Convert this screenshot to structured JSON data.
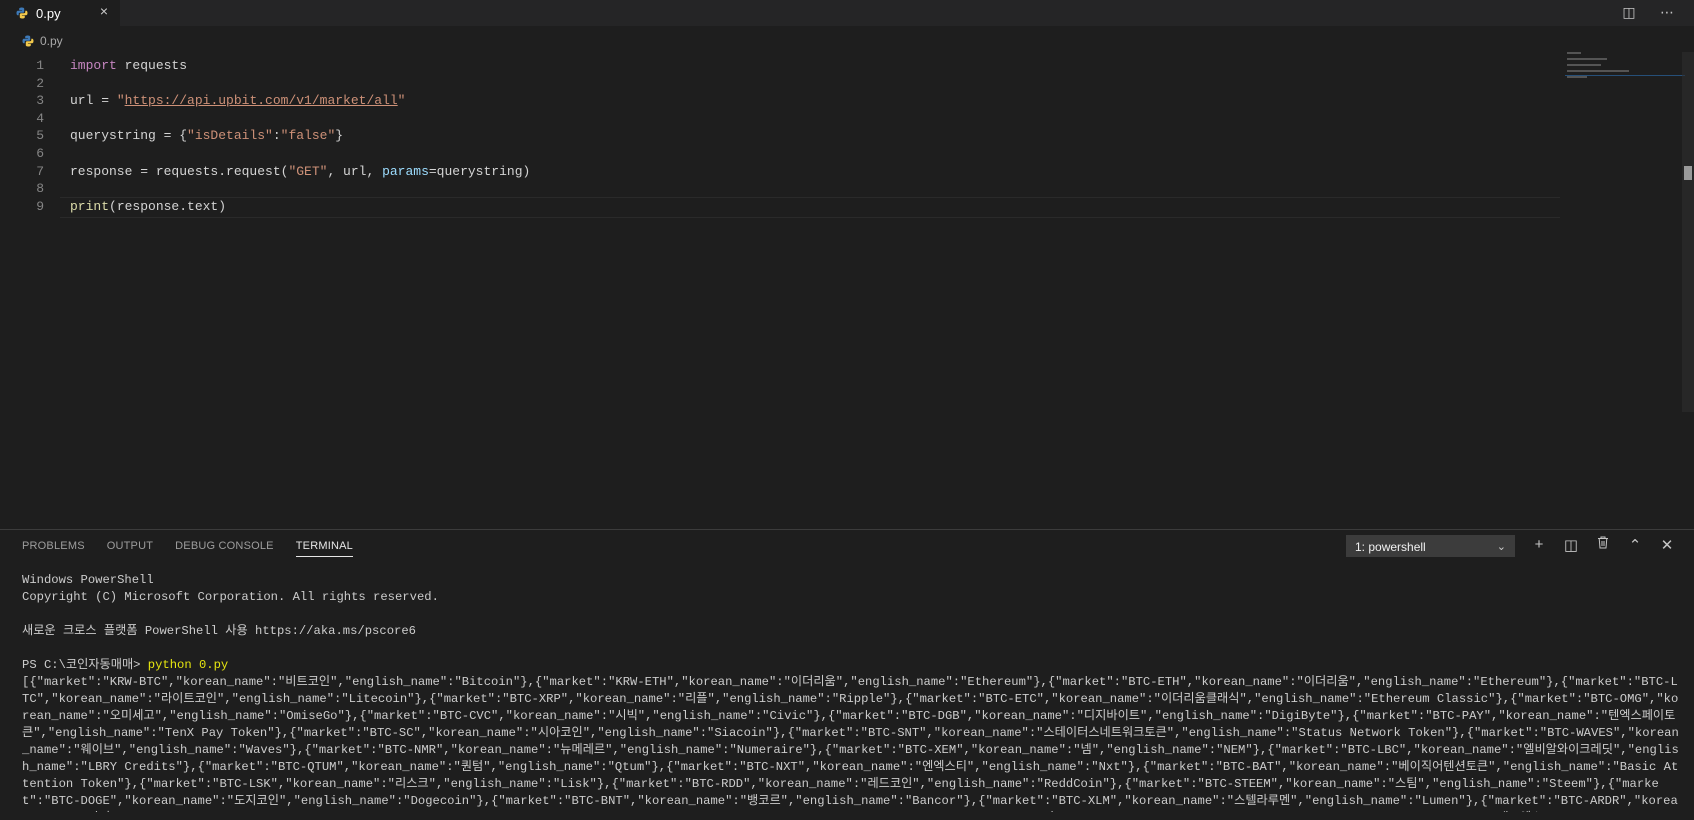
{
  "tab": {
    "filename": "0.py",
    "close": "×"
  },
  "tab_actions": {
    "split": "◫",
    "more": "⋯"
  },
  "breadcrumb": {
    "filename": "0.py"
  },
  "editor": {
    "lines": [
      {
        "n": "1",
        "tokens": [
          {
            "t": "import",
            "c": "kw"
          },
          {
            "t": " requests",
            "c": "id"
          }
        ]
      },
      {
        "n": "2",
        "tokens": []
      },
      {
        "n": "3",
        "tokens": [
          {
            "t": "url = ",
            "c": "id"
          },
          {
            "t": "\"",
            "c": "str"
          },
          {
            "t": "https://api.upbit.com/v1/market/all",
            "c": "url"
          },
          {
            "t": "\"",
            "c": "str"
          }
        ]
      },
      {
        "n": "4",
        "tokens": []
      },
      {
        "n": "5",
        "tokens": [
          {
            "t": "querystring = {",
            "c": "id"
          },
          {
            "t": "\"isDetails\"",
            "c": "str"
          },
          {
            "t": ":",
            "c": "id"
          },
          {
            "t": "\"false\"",
            "c": "str"
          },
          {
            "t": "}",
            "c": "id"
          }
        ]
      },
      {
        "n": "6",
        "tokens": []
      },
      {
        "n": "7",
        "tokens": [
          {
            "t": "response = requests.request(",
            "c": "id"
          },
          {
            "t": "\"GET\"",
            "c": "str"
          },
          {
            "t": ", url, ",
            "c": "id"
          },
          {
            "t": "params",
            "c": "param"
          },
          {
            "t": "=querystring)",
            "c": "id"
          }
        ]
      },
      {
        "n": "8",
        "tokens": []
      },
      {
        "n": "9",
        "tokens": [
          {
            "t": "print",
            "c": "fn"
          },
          {
            "t": "(response.text)",
            "c": "id"
          }
        ]
      }
    ]
  },
  "panel": {
    "tabs": [
      "PROBLEMS",
      "OUTPUT",
      "DEBUG CONSOLE",
      "TERMINAL"
    ],
    "active_tab": "TERMINAL",
    "terminal_select": "1: powershell",
    "icons": {
      "add": "+",
      "split": "◫",
      "trash": "🗑",
      "maximize": "⌃",
      "close": "✕"
    }
  },
  "terminal": {
    "line1": "Windows PowerShell",
    "line2": "Copyright (C) Microsoft Corporation. All rights reserved.",
    "line3": "",
    "line4": "새로운 크로스 플랫폼 PowerShell 사용 https://aka.ms/pscore6",
    "line5": "",
    "prompt": "PS C:\\코인자동매매> ",
    "command": "python 0.py",
    "output": "[{\"market\":\"KRW-BTC\",\"korean_name\":\"비트코인\",\"english_name\":\"Bitcoin\"},{\"market\":\"KRW-ETH\",\"korean_name\":\"이더리움\",\"english_name\":\"Ethereum\"},{\"market\":\"BTC-ETH\",\"korean_name\":\"이더리움\",\"english_name\":\"Ethereum\"},{\"market\":\"BTC-LTC\",\"korean_name\":\"라이트코인\",\"english_name\":\"Litecoin\"},{\"market\":\"BTC-XRP\",\"korean_name\":\"리플\",\"english_name\":\"Ripple\"},{\"market\":\"BTC-ETC\",\"korean_name\":\"이더리움클래식\",\"english_name\":\"Ethereum Classic\"},{\"market\":\"BTC-OMG\",\"korean_name\":\"오미세고\",\"english_name\":\"OmiseGo\"},{\"market\":\"BTC-CVC\",\"korean_name\":\"시빅\",\"english_name\":\"Civic\"},{\"market\":\"BTC-DGB\",\"korean_name\":\"디지바이트\",\"english_name\":\"DigiByte\"},{\"market\":\"BTC-PAY\",\"korean_name\":\"텐엑스페이토큰\",\"english_name\":\"TenX Pay Token\"},{\"market\":\"BTC-SC\",\"korean_name\":\"시아코인\",\"english_name\":\"Siacoin\"},{\"market\":\"BTC-SNT\",\"korean_name\":\"스테이터스네트워크토큰\",\"english_name\":\"Status Network Token\"},{\"market\":\"BTC-WAVES\",\"korean_name\":\"웨이브\",\"english_name\":\"Waves\"},{\"market\":\"BTC-NMR\",\"korean_name\":\"뉴메레르\",\"english_name\":\"Numeraire\"},{\"market\":\"BTC-XEM\",\"korean_name\":\"넴\",\"english_name\":\"NEM\"},{\"market\":\"BTC-LBC\",\"korean_name\":\"엘비알와이크레딧\",\"english_name\":\"LBRY Credits\"},{\"market\":\"BTC-QTUM\",\"korean_name\":\"퀀텀\",\"english_name\":\"Qtum\"},{\"market\":\"BTC-NXT\",\"korean_name\":\"엔엑스티\",\"english_name\":\"Nxt\"},{\"market\":\"BTC-BAT\",\"korean_name\":\"베이직어텐션토큰\",\"english_name\":\"Basic Attention Token\"},{\"market\":\"BTC-LSK\",\"korean_name\":\"리스크\",\"english_name\":\"Lisk\"},{\"market\":\"BTC-RDD\",\"korean_name\":\"레드코인\",\"english_name\":\"ReddCoin\"},{\"market\":\"BTC-STEEM\",\"korean_name\":\"스팀\",\"english_name\":\"Steem\"},{\"market\":\"BTC-DOGE\",\"korean_name\":\"도지코인\",\"english_name\":\"Dogecoin\"},{\"market\":\"BTC-BNT\",\"korean_name\":\"뱅코르\",\"english_name\":\"Bancor\"},{\"market\":\"BTC-XLM\",\"korean_name\":\"스텔라루멘\",\"english_name\":\"Lumen\"},{\"market\":\"BTC-ARDR\",\"korean_name\":\"아더\",\"english_name\":\"Ardor\"},{\"market\":\"BTC-KMD\",\"korean_name\":\"코모도\",\"english_name\":\"Komodo\"},{\"market\":\"BTC-ARK\",\"korean_name\":\"아크\",\"english_name\":\"Ark\"},{\"market\":\"BTC-ADX\",\"korean_name\":\"애드엑스\",\"english_name\":\"AdEx\"},{\"market\":\"BTC-SYS\",\"korean_name\":\"시스코인\",\"english_name\":\"Syscoin\"}"
  },
  "colors": {
    "editor_bg": "#1e1e1e",
    "keyword": "#c586c0",
    "string": "#ce9178",
    "function": "#dcdcaa",
    "param": "#9cdcfe",
    "command": "#e5e510"
  }
}
